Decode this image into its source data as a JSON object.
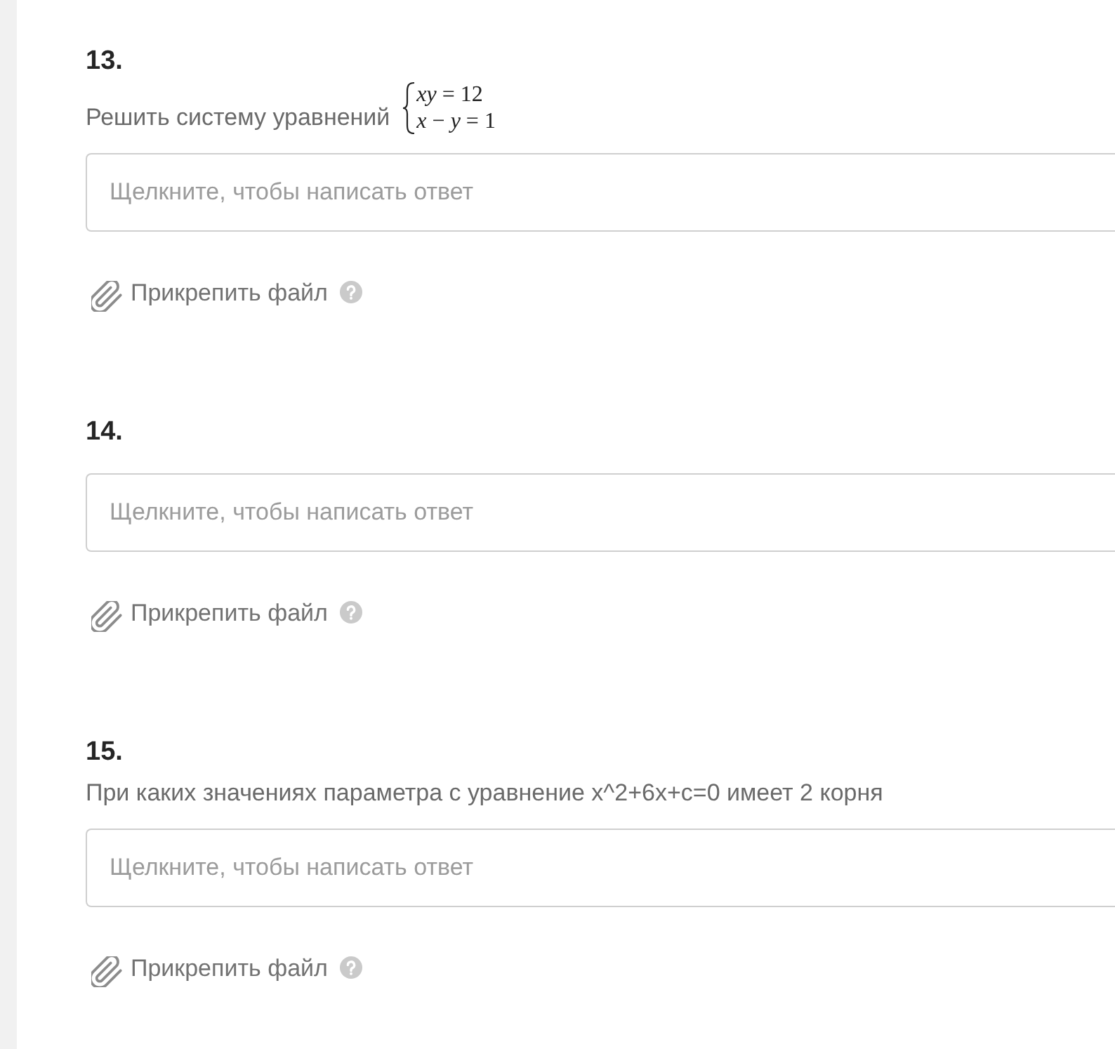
{
  "questions": [
    {
      "number": "13.",
      "prompt": {
        "text": "Решить систему уравнений",
        "system": [
          "*xy* = 12",
          "*x* − *y* = 1"
        ]
      },
      "answer": {
        "placeholder": "Щелкните, чтобы написать ответ"
      },
      "attach": {
        "label": "Прикрепить файл"
      }
    },
    {
      "number": "14.",
      "answer": {
        "placeholder": "Щелкните, чтобы написать ответ"
      },
      "attach": {
        "label": "Прикрепить файл"
      }
    },
    {
      "number": "15.",
      "prompt": {
        "text": "При каких значениях параметра с уравнение x^2+6x+c=0 имеет 2 корня"
      },
      "answer": {
        "placeholder": "Щелкните, чтобы написать ответ"
      },
      "attach": {
        "label": "Прикрепить файл"
      }
    }
  ]
}
